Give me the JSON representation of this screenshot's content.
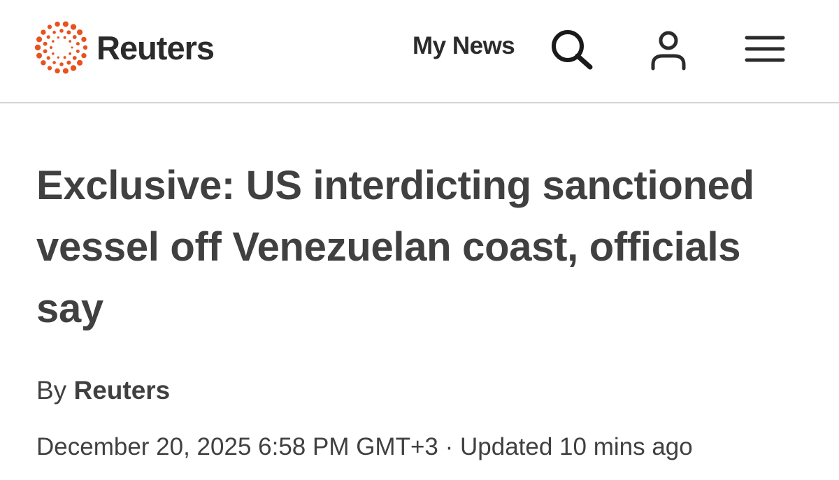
{
  "header": {
    "brand": "Reuters",
    "my_news_label": "My News",
    "icons": {
      "logo": "reuters-dot-ring-logo",
      "search": "search-icon",
      "account": "user-icon",
      "menu": "hamburger-menu-icon"
    },
    "colors": {
      "logo_accent": "#e9521f",
      "text": "#2b2b2b",
      "divider": "#d4d4d4"
    }
  },
  "article": {
    "headline": "Exclusive: US interdicting sanctioned vessel off Venezuelan coast, officials say",
    "byline_prefix": "By",
    "author": "Reuters",
    "published": "December 20, 2025 6:58 PM GMT+3",
    "separator": "·",
    "updated": "Updated 10 mins ago"
  }
}
